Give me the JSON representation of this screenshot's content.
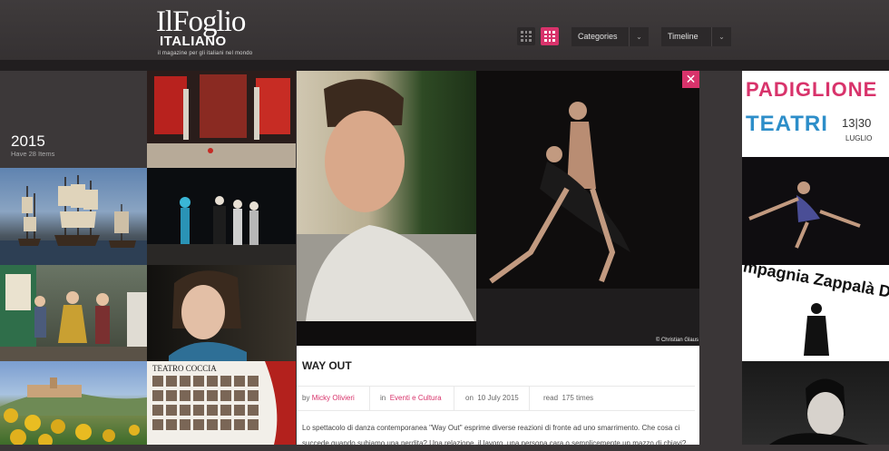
{
  "header": {
    "logo_line1": "IlFoglio",
    "logo_line2": "ITALIANO",
    "logo_tagline": "il magazine per gli italiani nel mondo",
    "categories_label": "Categories",
    "timeline_label": "Timeline"
  },
  "year_panel": {
    "year": "2015",
    "count": "Have 28 Items"
  },
  "article": {
    "title": "WAY OUT",
    "by_prefix": "by",
    "author": "Micky Olivieri",
    "in_prefix": "in",
    "category": "Eventi e Cultura",
    "on_prefix": "on",
    "date": "10 July 2015",
    "read_prefix": "read",
    "reads": "175 times",
    "photo_credit": "© Christian Glaus",
    "body_line1": "Lo spettacolo di danza contemporanea \"Way Out\" esprime diverse reazioni di fronte ad uno smarrimento. Che cosa ci",
    "body_line2": "succede quando subiamo una perdita? Una relazione, il lavoro, una persona cara o semplicemente un mazzo di chiavi?"
  },
  "tiles": {
    "padiglione_line1": "PADIGLIONE",
    "padiglione_line2": "TEATRI",
    "padiglione_dates": "13|30",
    "padiglione_month": "LUGLIO",
    "compagnia_text": "mpagnia Zappalà Da",
    "teatro_title": "TEATRO COCCIA"
  },
  "colors": {
    "accent": "#d8336b",
    "background": "#3a3637"
  }
}
